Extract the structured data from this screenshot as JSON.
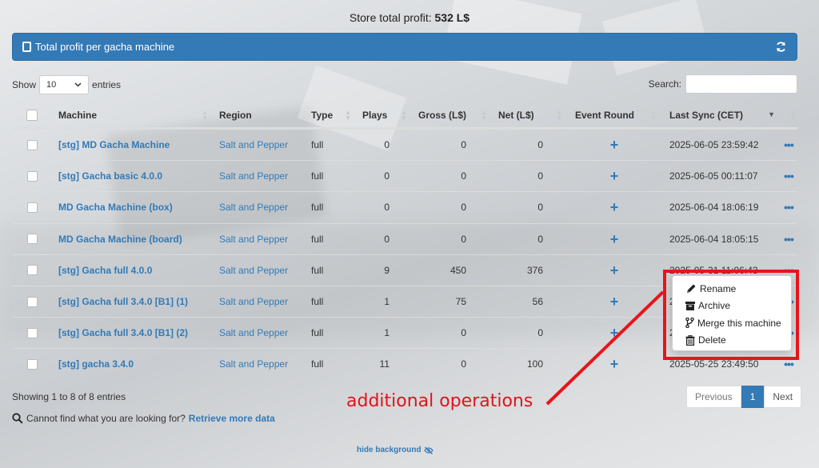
{
  "store_total": {
    "label": "Store total profit:",
    "value": "532 L$"
  },
  "panel": {
    "title": "Total profit per gacha machine",
    "icon": "tablet-icon",
    "refresh_icon": "refresh-icon"
  },
  "length_menu": {
    "show_label": "Show",
    "value": "10",
    "entries_label": "entries"
  },
  "search": {
    "label": "Search:",
    "value": ""
  },
  "columns": [
    "Machine",
    "Region",
    "Type",
    "Plays",
    "Gross (L$)",
    "Net (L$)",
    "Event Round",
    "Last Sync (CET)"
  ],
  "rows": [
    {
      "machine": "[stg] MD Gacha Machine",
      "region": "Salt and Pepper",
      "type": "full",
      "plays": "0",
      "gross": "0",
      "net": "0",
      "event": "+",
      "sync": "2025-06-05 23:59:42"
    },
    {
      "machine": "[stg] Gacha basic 4.0.0",
      "region": "Salt and Pepper",
      "type": "full",
      "plays": "0",
      "gross": "0",
      "net": "0",
      "event": "+",
      "sync": "2025-06-05 00:11:07"
    },
    {
      "machine": "MD Gacha Machine (box)",
      "region": "Salt and Pepper",
      "type": "full",
      "plays": "0",
      "gross": "0",
      "net": "0",
      "event": "+",
      "sync": "2025-06-04 18:06:19"
    },
    {
      "machine": "MD Gacha Machine (board)",
      "region": "Salt and Pepper",
      "type": "full",
      "plays": "0",
      "gross": "0",
      "net": "0",
      "event": "+",
      "sync": "2025-06-04 18:05:15"
    },
    {
      "machine": "[stg] Gacha full 4.0.0",
      "region": "Salt and Pepper",
      "type": "full",
      "plays": "9",
      "gross": "450",
      "net": "376",
      "event": "+",
      "sync": "2025-05-31 11:06:43"
    },
    {
      "machine": "[stg] Gacha full 3.4.0 [B1] (1)",
      "region": "Salt and Pepper",
      "type": "full",
      "plays": "1",
      "gross": "75",
      "net": "56",
      "event": "+",
      "sync": "20"
    },
    {
      "machine": "[stg] Gacha full 3.4.0 [B1] (2)",
      "region": "Salt and Pepper",
      "type": "full",
      "plays": "1",
      "gross": "0",
      "net": "0",
      "event": "+",
      "sync": "20"
    },
    {
      "machine": "[stg] gacha 3.4.0",
      "region": "Salt and Pepper",
      "type": "full",
      "plays": "11",
      "gross": "0",
      "net": "100",
      "event": "+",
      "sync": "2025-05-25 23:49:50"
    }
  ],
  "ops_symbol": "•••",
  "info": "Showing 1 to 8 of 8 entries",
  "pagination": {
    "previous": "Previous",
    "current": "1",
    "next": "Next"
  },
  "footer": {
    "question": "Cannot find what you are looking for?",
    "link": "Retrieve more data",
    "hide_bg": "hide background"
  },
  "dropdown": [
    {
      "label": "Rename",
      "icon": "pencil-icon"
    },
    {
      "label": "Archive",
      "icon": "archive-icon"
    },
    {
      "label": "Merge this machine",
      "icon": "code-fork-icon"
    },
    {
      "label": "Delete",
      "icon": "trash-icon"
    }
  ],
  "annotation": {
    "text": "additional operations",
    "color": "#e0141b"
  },
  "colors": {
    "primary": "#337ab7"
  }
}
